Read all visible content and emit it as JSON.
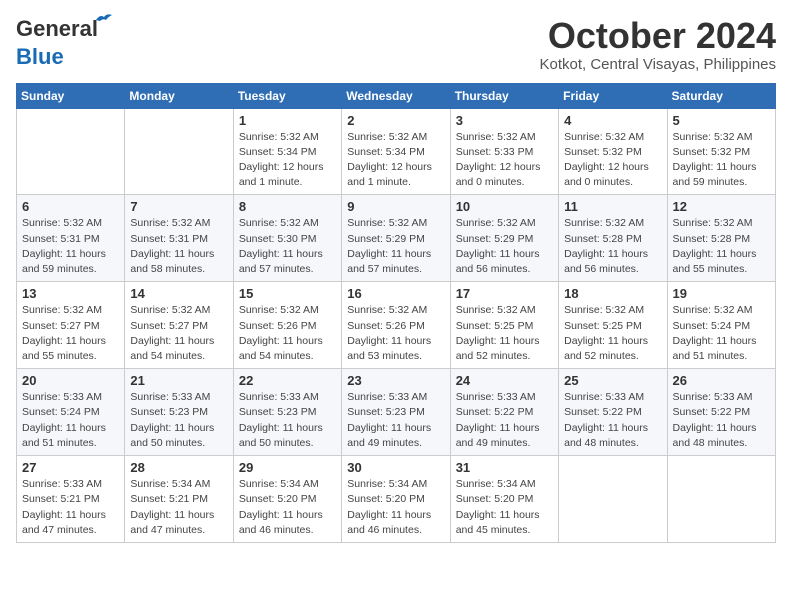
{
  "header": {
    "logo_line1": "General",
    "logo_line2": "Blue",
    "month": "October 2024",
    "location": "Kotkot, Central Visayas, Philippines"
  },
  "weekdays": [
    "Sunday",
    "Monday",
    "Tuesday",
    "Wednesday",
    "Thursday",
    "Friday",
    "Saturday"
  ],
  "weeks": [
    [
      {
        "day": "",
        "info": ""
      },
      {
        "day": "",
        "info": ""
      },
      {
        "day": "1",
        "info": "Sunrise: 5:32 AM\nSunset: 5:34 PM\nDaylight: 12 hours and 1 minute."
      },
      {
        "day": "2",
        "info": "Sunrise: 5:32 AM\nSunset: 5:34 PM\nDaylight: 12 hours and 1 minute."
      },
      {
        "day": "3",
        "info": "Sunrise: 5:32 AM\nSunset: 5:33 PM\nDaylight: 12 hours and 0 minutes."
      },
      {
        "day": "4",
        "info": "Sunrise: 5:32 AM\nSunset: 5:32 PM\nDaylight: 12 hours and 0 minutes."
      },
      {
        "day": "5",
        "info": "Sunrise: 5:32 AM\nSunset: 5:32 PM\nDaylight: 11 hours and 59 minutes."
      }
    ],
    [
      {
        "day": "6",
        "info": "Sunrise: 5:32 AM\nSunset: 5:31 PM\nDaylight: 11 hours and 59 minutes."
      },
      {
        "day": "7",
        "info": "Sunrise: 5:32 AM\nSunset: 5:31 PM\nDaylight: 11 hours and 58 minutes."
      },
      {
        "day": "8",
        "info": "Sunrise: 5:32 AM\nSunset: 5:30 PM\nDaylight: 11 hours and 57 minutes."
      },
      {
        "day": "9",
        "info": "Sunrise: 5:32 AM\nSunset: 5:29 PM\nDaylight: 11 hours and 57 minutes."
      },
      {
        "day": "10",
        "info": "Sunrise: 5:32 AM\nSunset: 5:29 PM\nDaylight: 11 hours and 56 minutes."
      },
      {
        "day": "11",
        "info": "Sunrise: 5:32 AM\nSunset: 5:28 PM\nDaylight: 11 hours and 56 minutes."
      },
      {
        "day": "12",
        "info": "Sunrise: 5:32 AM\nSunset: 5:28 PM\nDaylight: 11 hours and 55 minutes."
      }
    ],
    [
      {
        "day": "13",
        "info": "Sunrise: 5:32 AM\nSunset: 5:27 PM\nDaylight: 11 hours and 55 minutes."
      },
      {
        "day": "14",
        "info": "Sunrise: 5:32 AM\nSunset: 5:27 PM\nDaylight: 11 hours and 54 minutes."
      },
      {
        "day": "15",
        "info": "Sunrise: 5:32 AM\nSunset: 5:26 PM\nDaylight: 11 hours and 54 minutes."
      },
      {
        "day": "16",
        "info": "Sunrise: 5:32 AM\nSunset: 5:26 PM\nDaylight: 11 hours and 53 minutes."
      },
      {
        "day": "17",
        "info": "Sunrise: 5:32 AM\nSunset: 5:25 PM\nDaylight: 11 hours and 52 minutes."
      },
      {
        "day": "18",
        "info": "Sunrise: 5:32 AM\nSunset: 5:25 PM\nDaylight: 11 hours and 52 minutes."
      },
      {
        "day": "19",
        "info": "Sunrise: 5:32 AM\nSunset: 5:24 PM\nDaylight: 11 hours and 51 minutes."
      }
    ],
    [
      {
        "day": "20",
        "info": "Sunrise: 5:33 AM\nSunset: 5:24 PM\nDaylight: 11 hours and 51 minutes."
      },
      {
        "day": "21",
        "info": "Sunrise: 5:33 AM\nSunset: 5:23 PM\nDaylight: 11 hours and 50 minutes."
      },
      {
        "day": "22",
        "info": "Sunrise: 5:33 AM\nSunset: 5:23 PM\nDaylight: 11 hours and 50 minutes."
      },
      {
        "day": "23",
        "info": "Sunrise: 5:33 AM\nSunset: 5:23 PM\nDaylight: 11 hours and 49 minutes."
      },
      {
        "day": "24",
        "info": "Sunrise: 5:33 AM\nSunset: 5:22 PM\nDaylight: 11 hours and 49 minutes."
      },
      {
        "day": "25",
        "info": "Sunrise: 5:33 AM\nSunset: 5:22 PM\nDaylight: 11 hours and 48 minutes."
      },
      {
        "day": "26",
        "info": "Sunrise: 5:33 AM\nSunset: 5:22 PM\nDaylight: 11 hours and 48 minutes."
      }
    ],
    [
      {
        "day": "27",
        "info": "Sunrise: 5:33 AM\nSunset: 5:21 PM\nDaylight: 11 hours and 47 minutes."
      },
      {
        "day": "28",
        "info": "Sunrise: 5:34 AM\nSunset: 5:21 PM\nDaylight: 11 hours and 47 minutes."
      },
      {
        "day": "29",
        "info": "Sunrise: 5:34 AM\nSunset: 5:20 PM\nDaylight: 11 hours and 46 minutes."
      },
      {
        "day": "30",
        "info": "Sunrise: 5:34 AM\nSunset: 5:20 PM\nDaylight: 11 hours and 46 minutes."
      },
      {
        "day": "31",
        "info": "Sunrise: 5:34 AM\nSunset: 5:20 PM\nDaylight: 11 hours and 45 minutes."
      },
      {
        "day": "",
        "info": ""
      },
      {
        "day": "",
        "info": ""
      }
    ]
  ]
}
